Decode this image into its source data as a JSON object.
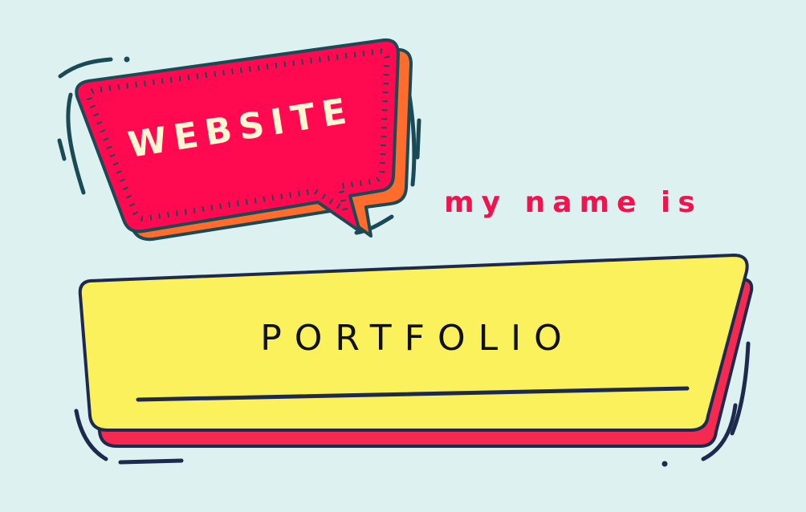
{
  "badge": {
    "label": "WEBSITE"
  },
  "tagline": {
    "text": "my name is"
  },
  "nameplate": {
    "name": "PORTFOLIO"
  },
  "colors": {
    "background": "#dcf1f0",
    "bubble_fill": "#ff0a50",
    "bubble_shadow": "#ff6c2c",
    "outline": "#1a4a55",
    "badge_text": "#fff6d2",
    "tagline": "#f0134d",
    "plate_fill": "#fbf15c",
    "plate_shadow": "#f52a50",
    "plate_outline": "#1d2a4e",
    "name_text": "#111111"
  }
}
